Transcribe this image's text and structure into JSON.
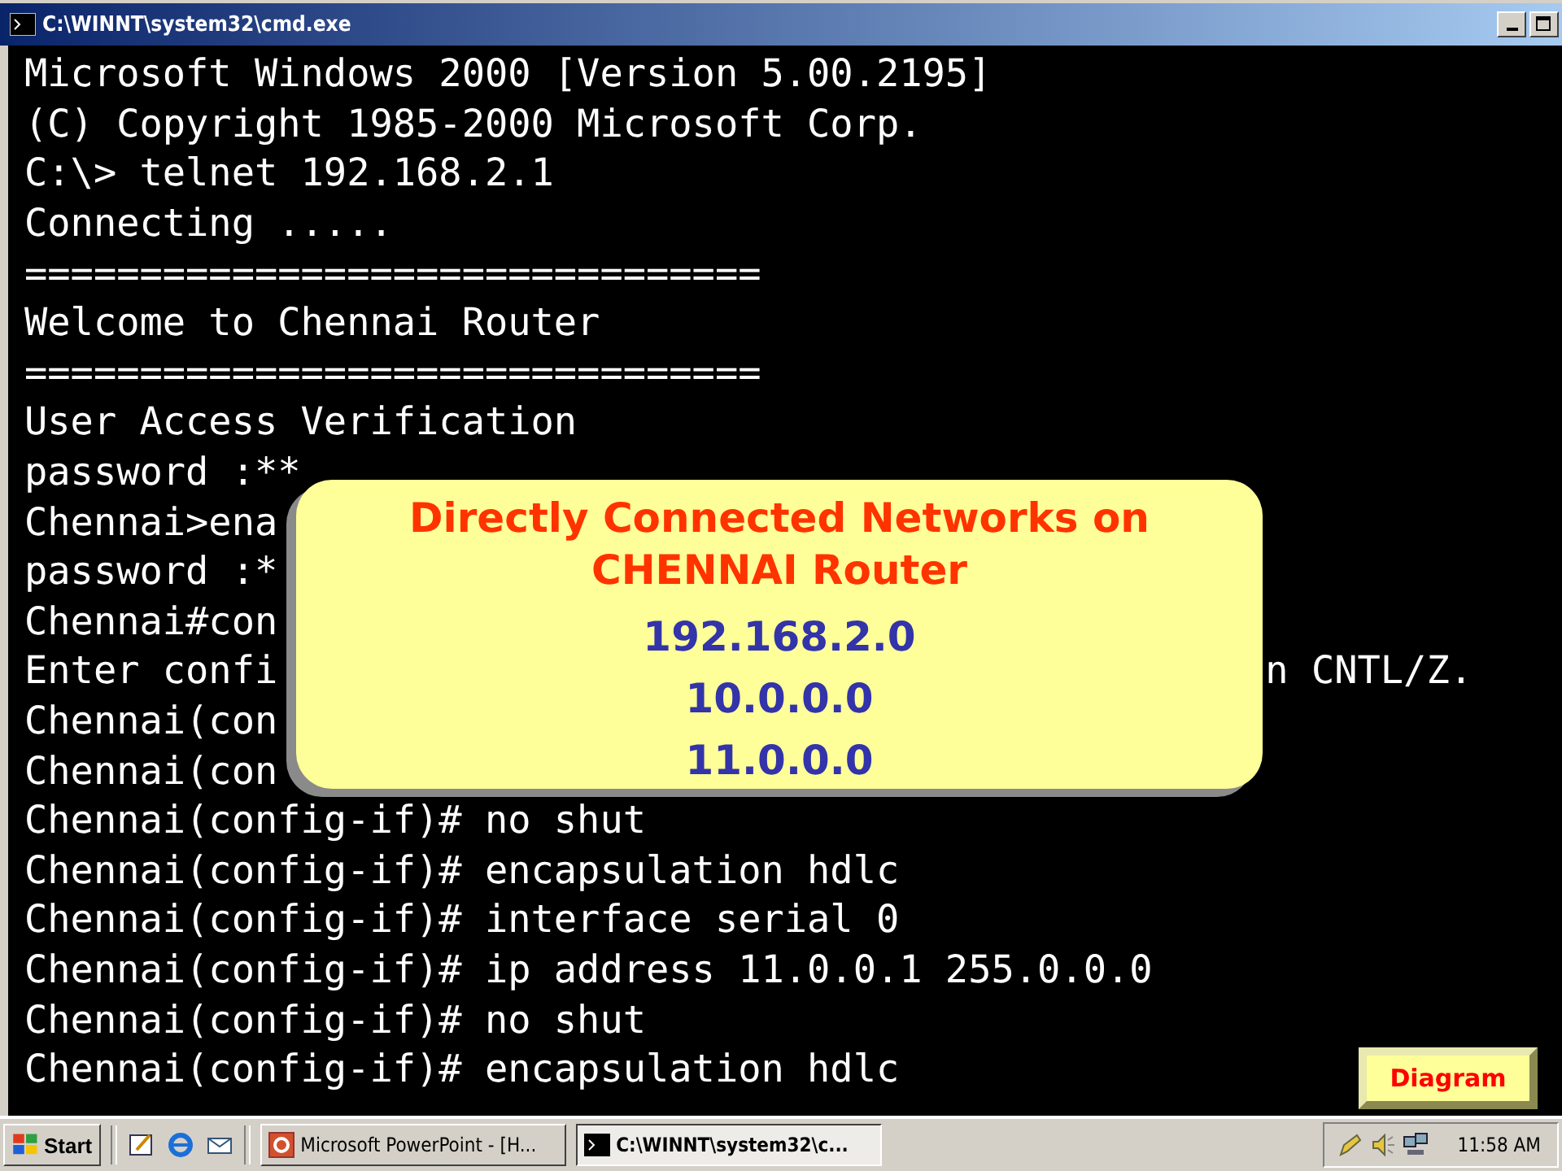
{
  "window": {
    "title": "C:\\WINNT\\system32\\cmd.exe"
  },
  "console_lines": [
    {
      "text": "Microsoft Windows 2000 [Version 5.00.2195]"
    },
    {
      "text": "(C) Copyright 1985-2000 Microsoft Corp."
    },
    {
      "text": "C:\\> telnet 192.168.2.1"
    },
    {
      "text": "Connecting ....."
    },
    {
      "text": "================================"
    },
    {
      "text": "Welcome to Chennai Router"
    },
    {
      "text": "================================"
    },
    {
      "text": "User Access Verification"
    },
    {
      "text": "password :**"
    },
    {
      "text": "Chennai>ena"
    },
    {
      "text": "password :*"
    },
    {
      "text": "Chennai#con"
    },
    {
      "text": "Enter confi",
      "tail": "n CNTL/Z."
    },
    {
      "text": "Chennai(con"
    },
    {
      "text": "Chennai(con"
    },
    {
      "text": "Chennai(config-if)# no shut"
    },
    {
      "text": "Chennai(config-if)# encapsulation hdlc"
    },
    {
      "text": "Chennai(config-if)# interface serial 0"
    },
    {
      "text": "Chennai(config-if)# ip address 11.0.0.1 255.0.0.0"
    },
    {
      "text": "Chennai(config-if)# no shut"
    },
    {
      "text": "Chennai(config-if)# encapsulation hdlc"
    }
  ],
  "callout": {
    "title": "Directly Connected Networks on CHENNAI Router",
    "networks": [
      "192.168.2.0",
      "10.0.0.0",
      "11.0.0.0"
    ]
  },
  "diagram_button": "Diagram",
  "taskbar": {
    "start": "Start",
    "tasks": [
      {
        "label": "Microsoft PowerPoint - [H...",
        "selected": false
      },
      {
        "label": "C:\\WINNT\\system32\\c...",
        "selected": true
      }
    ],
    "clock": "11:58 AM"
  }
}
